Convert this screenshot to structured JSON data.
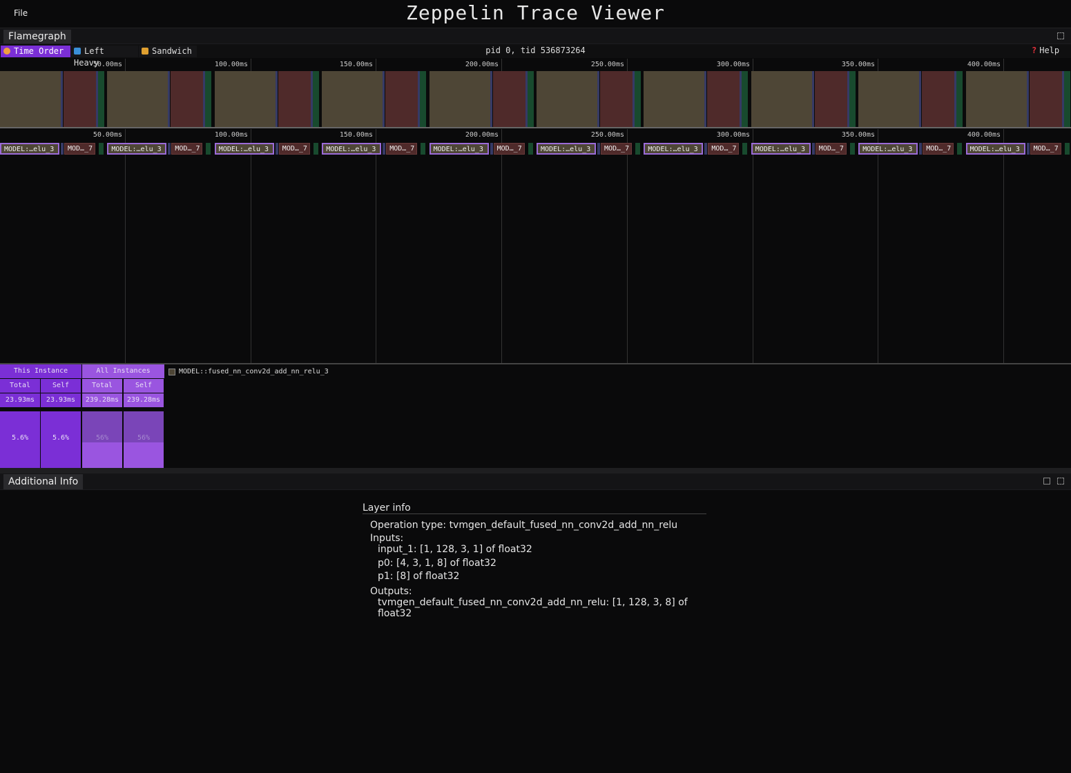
{
  "menu": {
    "file": "File"
  },
  "app_title": "Zeppelin Trace Viewer",
  "flamegraph_panel": {
    "tab_label": "Flamegraph",
    "view_modes": [
      {
        "label": "Time Order",
        "icon": "clock-icon",
        "active": true
      },
      {
        "label": "Left Heavy",
        "icon": "arrow-left-icon",
        "active": false
      },
      {
        "label": "Sandwich",
        "icon": "sandwich-icon",
        "active": false
      }
    ],
    "thread_label": "pid 0, tid 536873264",
    "help_label": "Help",
    "time_ticks": [
      "50.00ms",
      "100.00ms",
      "150.00ms",
      "200.00ms",
      "250.00ms",
      "300.00ms",
      "350.00ms",
      "400.00ms"
    ],
    "frames": [
      {
        "label": "MODEL:…elu_3"
      },
      {
        "label": "MOD…_7"
      }
    ]
  },
  "stats": {
    "groups": [
      "This Instance",
      "All Instances"
    ],
    "columns": [
      "Total",
      "Self",
      "Total",
      "Self"
    ],
    "times": [
      "23.93ms",
      "23.93ms",
      "239.28ms",
      "239.28ms"
    ],
    "percents": [
      "5.6%",
      "5.6%",
      "56%",
      "56%"
    ],
    "fractions": [
      0.056,
      0.056,
      0.56,
      0.56
    ],
    "selected_frame": "MODEL::fused_nn_conv2d_add_nn_relu_3"
  },
  "info_panel": {
    "tab_label": "Additional Info",
    "section_title": "Layer info",
    "operation_type": "Operation type: tvmgen_default_fused_nn_conv2d_add_nn_relu",
    "inputs_label": "Inputs:",
    "inputs": [
      "input_1: [1, 128, 3, 1] of float32",
      "p0: [4, 3, 1, 8] of float32",
      "p1: [8] of float32"
    ],
    "outputs_label": "Outputs:",
    "outputs": [
      "tvmgen_default_fused_nn_conv2d_add_nn_relu: [1, 128, 3, 8] of float32"
    ]
  },
  "colors": {
    "accent": "#7b2fd6",
    "conv_frame": "#4e4636",
    "other_frame": "#4f2a2a",
    "small_frame": "#184a2e",
    "background": "#0a0a0b"
  }
}
